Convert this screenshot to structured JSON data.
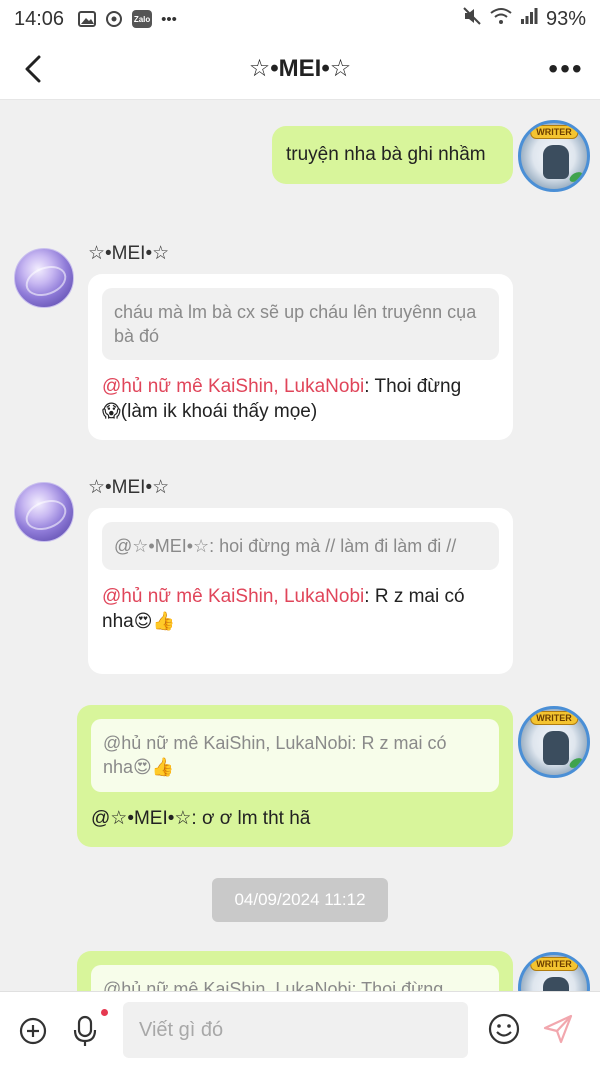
{
  "status_bar": {
    "time": "14:06",
    "battery": "93%",
    "icons": [
      "gallery-icon",
      "sync-icon",
      "zalo-icon",
      "more-dots-icon",
      "mute-icon",
      "wifi-icon",
      "signal-icon"
    ],
    "zalo_label": "Zalo",
    "dots": "•••"
  },
  "header": {
    "title": "☆•MEI•☆",
    "more": "•••"
  },
  "messages": [
    {
      "id": "m1",
      "side": "mine",
      "text": "truyện nha bà ghi nhầm"
    },
    {
      "id": "m2",
      "side": "theirs",
      "sender": "☆•MEI•☆",
      "quote": "cháu mà lm bà cx sẽ up cháu lên truyênn cụa bà đó",
      "mention": "@hủ nữ mê KaiShin, LukaNobi",
      "reply_line1": ": Thoi đừng",
      "reply_emoji": "😱",
      "reply_line2": "(làm ik khoái thấy mọe)"
    },
    {
      "id": "m3",
      "side": "theirs",
      "sender": "☆•MEI•☆",
      "quote": "@☆•MEI•☆: hoi đừng mà // làm đi làm đi //",
      "mention": "@hủ nữ mê KaiShin, LukaNobi",
      "reply_line1": ": R z mai có",
      "reply_line2": "nha",
      "reply_emoji": "😍👍"
    },
    {
      "id": "m4",
      "side": "mine",
      "quote_line1": "@hủ nữ mê KaiShin, LukaNobi: R z mai có",
      "quote_line2": "nha",
      "quote_emoji": "😍👍",
      "reply": "@☆•MEI•☆: ơ ơ lm tht hã"
    },
    {
      "id": "m5",
      "side": "mine",
      "quote_partial": "@hủ nữ mê KaiShin, LukaNobi: Thoi đừng"
    }
  ],
  "date_separator": "04/09/2024 11:12",
  "input_bar": {
    "placeholder": "Viết gì đó"
  },
  "colors": {
    "my_bubble": "#d8f59b",
    "their_bubble": "#ffffff",
    "mention": "#e0455a",
    "background": "#f0f0f0",
    "writer_tag": "WRITER"
  }
}
